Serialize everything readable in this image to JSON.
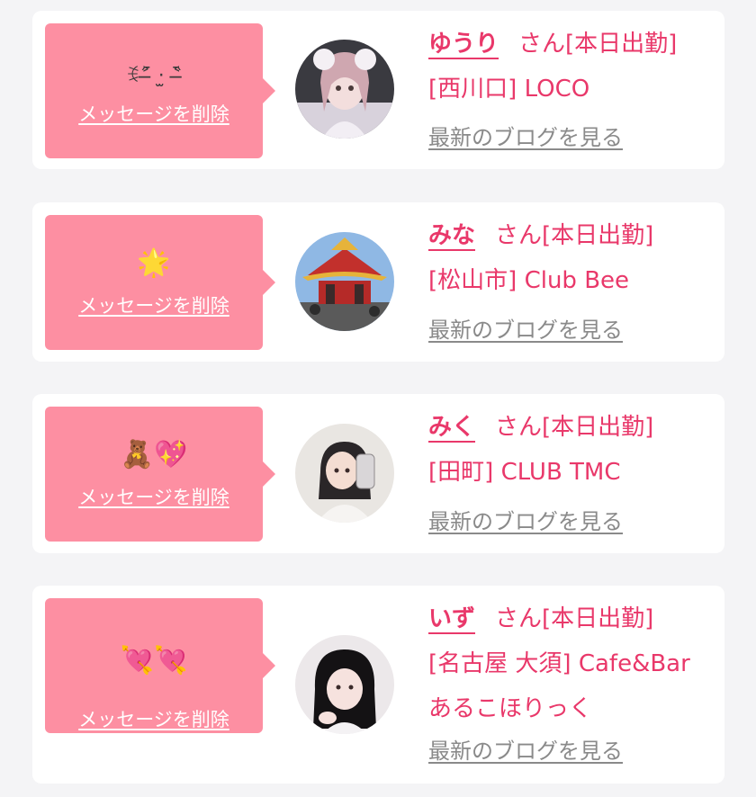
{
  "delete_label": "メッセージを削除",
  "blog_label": "最新のブログを見る",
  "honorific": "さん",
  "accent_color": "#e9386a",
  "bubble_color": "#fd8fa2",
  "cards": [
    {
      "message": "ꉂ˃̶᷇ ‧̫ ˂̶᷆",
      "name": "ゆうり",
      "status": "[本日出勤]",
      "area": "[西川口]",
      "shop": "LOCO",
      "avatar_icon": "girl-lolita-photo"
    },
    {
      "message": "🌟",
      "name": "みな",
      "status": "[本日出勤]",
      "area": "[松山市]",
      "shop": "Club Bee",
      "avatar_icon": "chinese-pavilion-photo"
    },
    {
      "message": "🧸💖",
      "name": "みく",
      "status": "[本日出勤]",
      "area": "[田町]",
      "shop": "CLUB TMC",
      "avatar_icon": "girl-selfie-photo"
    },
    {
      "message": "💘💘",
      "name": "いず",
      "status": "[本日出勤]",
      "area": "[名古屋 大須]",
      "shop": "Cafe&Bar あるこほりっく",
      "avatar_icon": "girl-black-hair-photo"
    }
  ]
}
